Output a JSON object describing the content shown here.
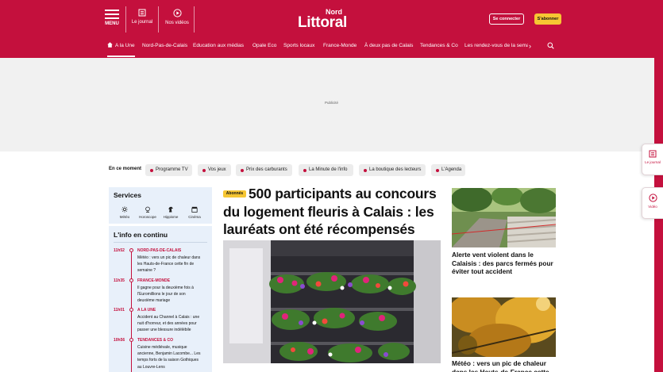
{
  "colors": {
    "brand": "#c4103d",
    "subscribe": "#f6c633",
    "panel": "#e8f0fa",
    "chip": "#ececec"
  },
  "header": {
    "menu_label": "MENU",
    "journal_label": "Le journal",
    "videos_label": "Nos vidéos",
    "logo_top": "Nord",
    "logo_main": "Littoral",
    "login_label": "Se connecter",
    "subscribe_label": "S'abonner"
  },
  "nav": {
    "items": [
      "A la Une",
      "Nord-Pas-de-Calais",
      "Education aux médias",
      "Opale Eco",
      "Sports locaux",
      "France-Monde",
      "À deux pas de Calais",
      "Tendances & Co",
      "Les rendez-vous de la semai"
    ],
    "home_icon": "home-icon",
    "more_icon": "chevron-right-icon",
    "search_icon": "search-icon"
  },
  "ad": {
    "label": "Publicité"
  },
  "side_tabs": {
    "journal": "Le journal",
    "video": "Vidéo"
  },
  "en_ce_moment": {
    "title": "En ce moment",
    "chips": [
      "Programme TV",
      "Vos jeux",
      "Prix des carburants",
      "La Minute de l'info",
      "La boutique des lecteurs",
      "L'Agenda"
    ]
  },
  "services": {
    "title": "Services",
    "items": [
      "Météo",
      "Horoscope",
      "Hippisme",
      "Cinéma"
    ]
  },
  "info_continu": {
    "title": "L'info en continu",
    "entries": [
      {
        "time": "11h52",
        "category": "NORD-PAS-DE-CALAIS",
        "lines": [
          "Météo : vers un pic de chaleur dans",
          "les Hauts-de-France cette fin de",
          "semaine ?"
        ]
      },
      {
        "time": "11h35",
        "category": "FRANCE-MONDE",
        "lines": [
          "Il gagne pour la deuxième fois à",
          "l'Euromillions le jour de son",
          "deuxième mariage"
        ]
      },
      {
        "time": "11h01",
        "category": "A LA UNE",
        "lines": [
          "Accident au Channel à Calais : une",
          "nuit d'horreur, et des années pour",
          "passer une blessure indélébile"
        ]
      },
      {
        "time": "10h56",
        "category": "TENDANCES & CO",
        "lines": [
          "Cuisine médiévale, musique",
          "ancienne, Benjamin Lacombe... Les",
          "temps forts de la saison Gothiques",
          "au Louvre-Lens"
        ]
      }
    ]
  },
  "main_article": {
    "badge": "Abonnés",
    "title": "500 participants au concours du logement fleuris à Calais : les lauréats ont été récompensés"
  },
  "side_articles": [
    {
      "title": "Alerte vent violent dans le Calaisis : des parcs fermés pour éviter tout accident"
    },
    {
      "title": "Météo : vers un pic de chaleur dans les Hauts-de-France cette fin de"
    }
  ]
}
